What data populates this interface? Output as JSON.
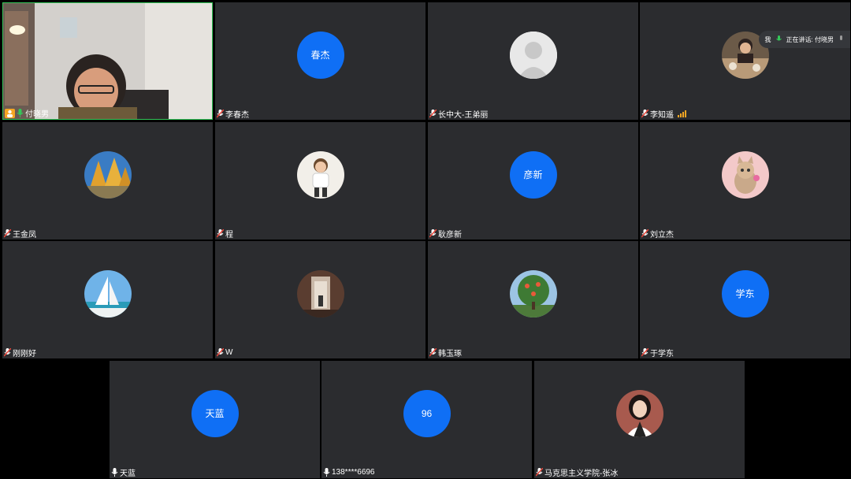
{
  "speaker_indicator": {
    "me_label": "我",
    "speaking_text": "正在讲话: 付晓男"
  },
  "participants": [
    {
      "name": "付晓男",
      "avatar_text": "",
      "avatar_kind": "video"
    },
    {
      "name": "李春杰",
      "avatar_text": "春杰",
      "avatar_kind": "text"
    },
    {
      "name": "长中大-王弟丽",
      "avatar_text": "",
      "avatar_kind": "default-person"
    },
    {
      "name": "李知遥",
      "avatar_text": "",
      "avatar_kind": "photo-food"
    },
    {
      "name": "王金凤",
      "avatar_text": "",
      "avatar_kind": "photo-trees"
    },
    {
      "name": "程",
      "avatar_text": "",
      "avatar_kind": "photo-child"
    },
    {
      "name": "耿彦新",
      "avatar_text": "彦新",
      "avatar_kind": "text"
    },
    {
      "name": "刘立杰",
      "avatar_text": "",
      "avatar_kind": "photo-cat"
    },
    {
      "name": "刚刚好",
      "avatar_text": "",
      "avatar_kind": "photo-sailboat"
    },
    {
      "name": "W",
      "avatar_text": "",
      "avatar_kind": "photo-hallway"
    },
    {
      "name": "韩玉琢",
      "avatar_text": "",
      "avatar_kind": "photo-tree"
    },
    {
      "name": "于学东",
      "avatar_text": "学东",
      "avatar_kind": "text"
    },
    {
      "name": "天蓝",
      "avatar_text": "天蓝",
      "avatar_kind": "text"
    },
    {
      "name": "138****6696",
      "avatar_text": "96",
      "avatar_kind": "text"
    },
    {
      "name": "马克思主义学院-张冰",
      "avatar_text": "",
      "avatar_kind": "photo-woman"
    }
  ],
  "colors": {
    "avatar_blue": "#0f6ff5",
    "tile_bg": "#2b2c2f",
    "active_border": "#34c759",
    "muted_mic": "#e8463a",
    "badge_orange": "#f5a623"
  }
}
